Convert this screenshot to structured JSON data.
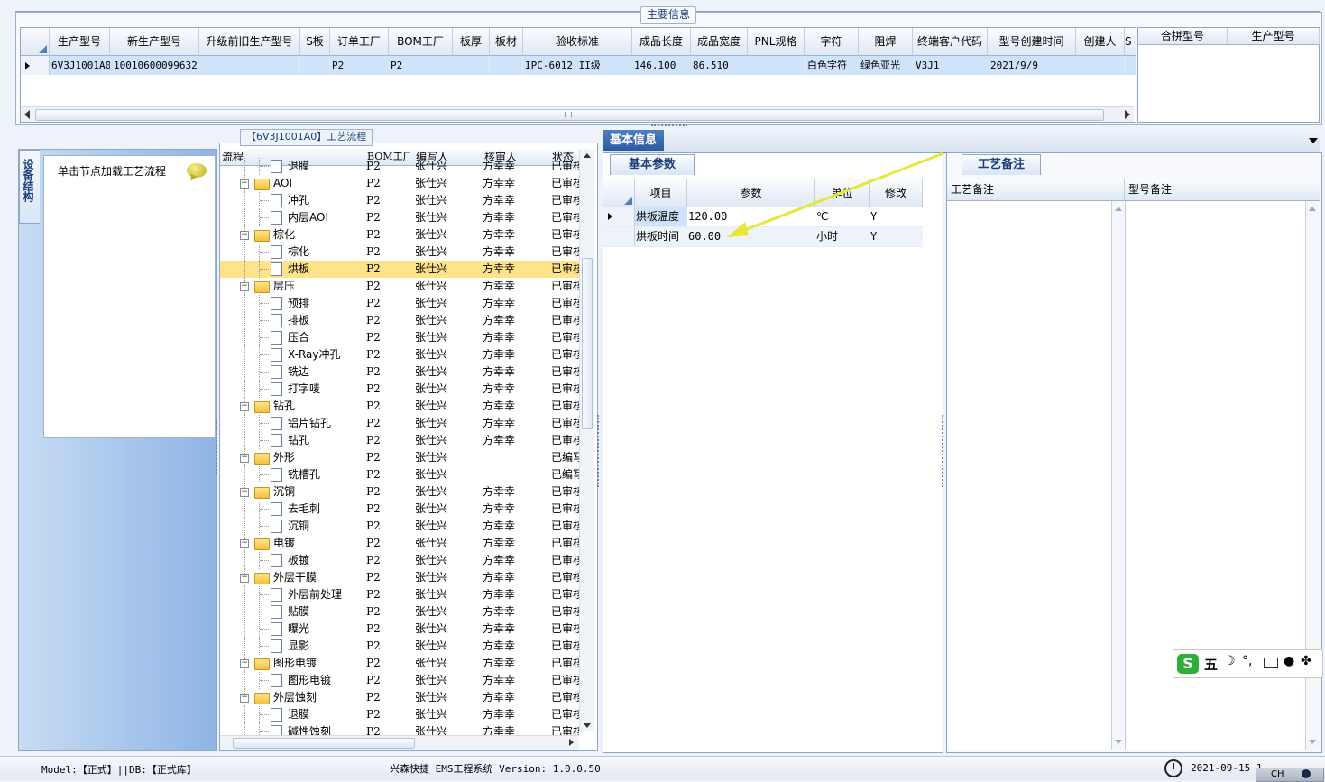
{
  "main_info": {
    "caption": "主要信息",
    "columns": [
      "生产型号",
      "新生产型号",
      "升级前旧生产型号",
      "S板",
      "订单工厂",
      "BOM工厂",
      "板厚",
      "板材",
      "验收标准",
      "成品长度",
      "成品宽度",
      "PNL规格",
      "字符",
      "阻焊",
      "终端客户代码",
      "型号创建时间",
      "创建人",
      "S"
    ],
    "row": {
      "prod_model": "6V3J1001A0",
      "new_prod_model": "10010600099632",
      "old_model": "",
      "s_board": "",
      "order_factory": "P2",
      "bom_factory": "P2",
      "thickness": "",
      "material": "",
      "standard": "IPC-6012 II级",
      "length": "146.100",
      "width": "86.510",
      "pnl": "",
      "character": "白色字符",
      "solder_mask": "绿色亚光",
      "customer_code": "V3J1",
      "created_time": "2021/9/9",
      "creator": ""
    },
    "merge_columns": [
      "合拼型号",
      "生产型号"
    ]
  },
  "sidebar": {
    "tab_label": "设备结构",
    "load_hint": "单击节点加载工艺流程"
  },
  "flow": {
    "caption": "【6V3J1001A0】工艺流程",
    "columns": [
      "流程",
      "BOM工厂",
      "编写人",
      "核审人",
      "状态"
    ],
    "rows": [
      {
        "level": 1,
        "type": "doc",
        "name": "退膜",
        "bom": "P2",
        "writer": "张仕兴",
        "reviewer": "方幸幸",
        "status": "已审核"
      },
      {
        "level": 0,
        "type": "folder",
        "name": "AOI",
        "bom": "P2",
        "writer": "张仕兴",
        "reviewer": "方幸幸",
        "status": "已审核"
      },
      {
        "level": 1,
        "type": "doc",
        "name": "冲孔",
        "bom": "P2",
        "writer": "张仕兴",
        "reviewer": "方幸幸",
        "status": "已审核"
      },
      {
        "level": 1,
        "type": "doc",
        "name": "内层AOI",
        "bom": "P2",
        "writer": "张仕兴",
        "reviewer": "方幸幸",
        "status": "已审核"
      },
      {
        "level": 0,
        "type": "folder",
        "name": "棕化",
        "bom": "P2",
        "writer": "张仕兴",
        "reviewer": "方幸幸",
        "status": "已审核"
      },
      {
        "level": 1,
        "type": "doc",
        "name": "棕化",
        "bom": "P2",
        "writer": "张仕兴",
        "reviewer": "方幸幸",
        "status": "已审核"
      },
      {
        "level": 1,
        "type": "doc",
        "name": "烘板",
        "bom": "P2",
        "writer": "张仕兴",
        "reviewer": "方幸幸",
        "status": "已审核",
        "selected": true
      },
      {
        "level": 0,
        "type": "folder",
        "name": "层压",
        "bom": "P2",
        "writer": "张仕兴",
        "reviewer": "方幸幸",
        "status": "已审核"
      },
      {
        "level": 1,
        "type": "doc",
        "name": "预排",
        "bom": "P2",
        "writer": "张仕兴",
        "reviewer": "方幸幸",
        "status": "已审核"
      },
      {
        "level": 1,
        "type": "doc",
        "name": "排板",
        "bom": "P2",
        "writer": "张仕兴",
        "reviewer": "方幸幸",
        "status": "已审核"
      },
      {
        "level": 1,
        "type": "doc",
        "name": "压合",
        "bom": "P2",
        "writer": "张仕兴",
        "reviewer": "方幸幸",
        "status": "已审核"
      },
      {
        "level": 1,
        "type": "doc",
        "name": "X-Ray冲孔",
        "bom": "P2",
        "writer": "张仕兴",
        "reviewer": "方幸幸",
        "status": "已审核"
      },
      {
        "level": 1,
        "type": "doc",
        "name": "铣边",
        "bom": "P2",
        "writer": "张仕兴",
        "reviewer": "方幸幸",
        "status": "已审核"
      },
      {
        "level": 1,
        "type": "doc",
        "name": "打字唛",
        "bom": "P2",
        "writer": "张仕兴",
        "reviewer": "方幸幸",
        "status": "已审核"
      },
      {
        "level": 0,
        "type": "folder",
        "name": "钻孔",
        "bom": "P2",
        "writer": "张仕兴",
        "reviewer": "方幸幸",
        "status": "已审核"
      },
      {
        "level": 1,
        "type": "doc",
        "name": "铝片钻孔",
        "bom": "P2",
        "writer": "张仕兴",
        "reviewer": "方幸幸",
        "status": "已审核"
      },
      {
        "level": 1,
        "type": "doc",
        "name": "钻孔",
        "bom": "P2",
        "writer": "张仕兴",
        "reviewer": "方幸幸",
        "status": "已审核"
      },
      {
        "level": 0,
        "type": "folder",
        "name": "外形",
        "bom": "P2",
        "writer": "张仕兴",
        "reviewer": "",
        "status": "已编写"
      },
      {
        "level": 1,
        "type": "doc",
        "name": "铣槽孔",
        "bom": "P2",
        "writer": "张仕兴",
        "reviewer": "",
        "status": "已编写"
      },
      {
        "level": 0,
        "type": "folder",
        "name": "沉铜",
        "bom": "P2",
        "writer": "张仕兴",
        "reviewer": "方幸幸",
        "status": "已审核"
      },
      {
        "level": 1,
        "type": "doc",
        "name": "去毛刺",
        "bom": "P2",
        "writer": "张仕兴",
        "reviewer": "方幸幸",
        "status": "已审核"
      },
      {
        "level": 1,
        "type": "doc",
        "name": "沉铜",
        "bom": "P2",
        "writer": "张仕兴",
        "reviewer": "方幸幸",
        "status": "已审核"
      },
      {
        "level": 0,
        "type": "folder",
        "name": "电镀",
        "bom": "P2",
        "writer": "张仕兴",
        "reviewer": "方幸幸",
        "status": "已审核"
      },
      {
        "level": 1,
        "type": "doc",
        "name": "板镀",
        "bom": "P2",
        "writer": "张仕兴",
        "reviewer": "方幸幸",
        "status": "已审核"
      },
      {
        "level": 0,
        "type": "folder",
        "name": "外层干膜",
        "bom": "P2",
        "writer": "张仕兴",
        "reviewer": "方幸幸",
        "status": "已审核"
      },
      {
        "level": 1,
        "type": "doc",
        "name": "外层前处理",
        "bom": "P2",
        "writer": "张仕兴",
        "reviewer": "方幸幸",
        "status": "已审核"
      },
      {
        "level": 1,
        "type": "doc",
        "name": "贴膜",
        "bom": "P2",
        "writer": "张仕兴",
        "reviewer": "方幸幸",
        "status": "已审核"
      },
      {
        "level": 1,
        "type": "doc",
        "name": "曝光",
        "bom": "P2",
        "writer": "张仕兴",
        "reviewer": "方幸幸",
        "status": "已审核"
      },
      {
        "level": 1,
        "type": "doc",
        "name": "显影",
        "bom": "P2",
        "writer": "张仕兴",
        "reviewer": "方幸幸",
        "status": "已审核"
      },
      {
        "level": 0,
        "type": "folder",
        "name": "图形电镀",
        "bom": "P2",
        "writer": "张仕兴",
        "reviewer": "方幸幸",
        "status": "已审核"
      },
      {
        "level": 1,
        "type": "doc",
        "name": "图形电镀",
        "bom": "P2",
        "writer": "张仕兴",
        "reviewer": "方幸幸",
        "status": "已审核"
      },
      {
        "level": 0,
        "type": "folder",
        "name": "外层蚀刻",
        "bom": "P2",
        "writer": "张仕兴",
        "reviewer": "方幸幸",
        "status": "已审核"
      },
      {
        "level": 1,
        "type": "doc",
        "name": "退膜",
        "bom": "P2",
        "writer": "张仕兴",
        "reviewer": "方幸幸",
        "status": "已审核"
      },
      {
        "level": 1,
        "type": "doc",
        "name": "碱性蚀刻",
        "bom": "P2",
        "writer": "张仕兴",
        "reviewer": "方幸幸",
        "status": "已审核"
      }
    ]
  },
  "basic_info": {
    "tab_label": "基本信息",
    "sub_tab": "基本参数",
    "columns": [
      "项目",
      "参数",
      "单位",
      "修改"
    ],
    "rows": [
      {
        "item": "烘板温度",
        "value": "120.00",
        "unit": "℃",
        "modify": "Y"
      },
      {
        "item": "烘板时间",
        "value": "60.00",
        "unit": "小时",
        "modify": "Y"
      }
    ]
  },
  "notes": {
    "tab_label": "工艺备注",
    "process_note_header": "工艺备注",
    "model_note_header": "型号备注"
  },
  "ime": {
    "mode": "五"
  },
  "status_bar": {
    "model_db": "Model:【正式】||DB:【正式库】",
    "app": "兴森快捷 EMS工程系统 Version: 1.0.0.50",
    "datetime": "2021-09-15 1",
    "lang": "CH"
  },
  "colors": {
    "accent": "#2c5aa0",
    "selected_row": "#cfe4fa",
    "highlight_row": "#ffe38a",
    "annotation_arrow": "#e7e73a"
  }
}
